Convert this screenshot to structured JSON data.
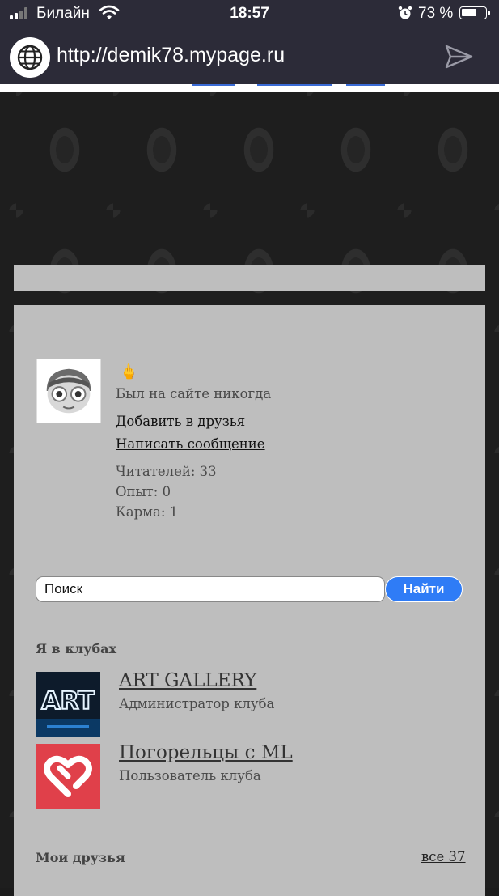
{
  "status_bar": {
    "carrier": "Билайн",
    "time": "18:57",
    "battery_percent": "73 %",
    "battery_level": 0.73
  },
  "browser": {
    "url": "http://demik78.mypage.ru"
  },
  "profile": {
    "gesture": "🖕",
    "last_seen": "Был на сайте никогда",
    "add_friend": "Добавить в друзья",
    "write_message": "Написать сообщение",
    "readers": "Читателей: 33",
    "experience": "Опыт: 0",
    "karma": "Карма: 1"
  },
  "search": {
    "value": "Поиск",
    "button": "Найти"
  },
  "clubs": {
    "title": "Я в клубах",
    "items": [
      {
        "name": "ART GALLERY",
        "role": "Администратор клуба",
        "image_text": "ART"
      },
      {
        "name": "Погорельцы с ML",
        "role": "Пользователь клуба"
      }
    ]
  },
  "friends": {
    "title": "Мои друзья",
    "all_link": "все 37"
  },
  "colors": {
    "panel": "#bebebe",
    "chrome": "#2c2b38",
    "search_button": "#2f7cf6",
    "club2_bg": "#e0404a"
  }
}
